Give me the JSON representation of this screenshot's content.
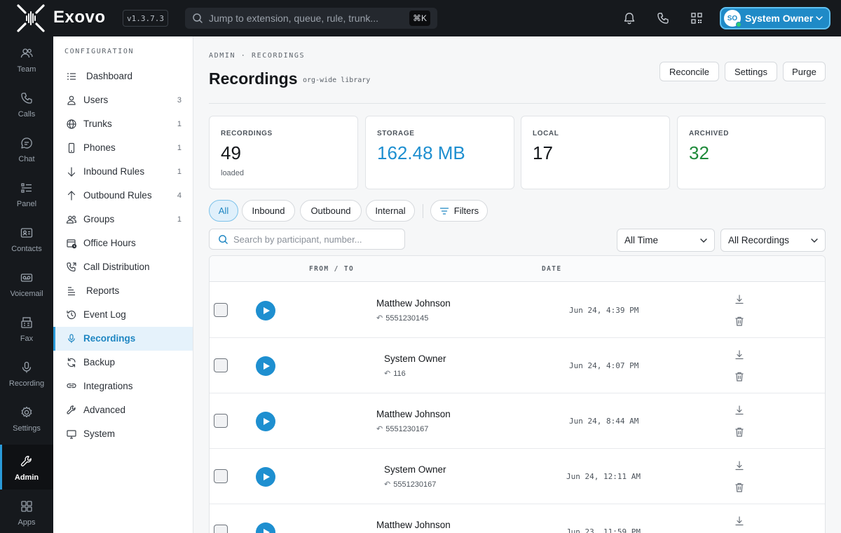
{
  "app": {
    "brand": "Exovo",
    "version": "v1.3.7.3",
    "search_placeholder": "Jump to extension, queue, rule, trunk...",
    "search_shortcut": "⌘K",
    "user": {
      "initials": "SO",
      "name": "System Owner"
    },
    "icons": [
      "logo-icon",
      "bell-icon",
      "phone-icon",
      "qr-icon",
      "chevron-down-icon"
    ]
  },
  "rail": [
    {
      "label": "Team",
      "icon": "team-icon"
    },
    {
      "label": "Calls",
      "icon": "phone-icon"
    },
    {
      "label": "Chat",
      "icon": "chat-icon"
    },
    {
      "label": "Panel",
      "icon": "panel-icon"
    },
    {
      "label": "Contacts",
      "icon": "contacts-icon"
    },
    {
      "label": "Voicemail",
      "icon": "voicemail-icon"
    },
    {
      "label": "Fax",
      "icon": "fax-icon"
    },
    {
      "label": "Recording",
      "icon": "mic-icon"
    },
    {
      "label": "Settings",
      "icon": "gear-icon"
    },
    {
      "label": "Admin",
      "icon": "wrench-icon",
      "active": true
    },
    {
      "label": "Apps",
      "icon": "apps-icon"
    }
  ],
  "config": {
    "heading": "CONFIGURATION",
    "items": [
      {
        "label": "Dashboard",
        "count": "",
        "icon": "dashboard-icon"
      },
      {
        "label": "Users",
        "count": "3",
        "icon": "user-icon"
      },
      {
        "label": "Trunks",
        "count": "1",
        "icon": "globe-icon"
      },
      {
        "label": "Phones",
        "count": "1",
        "icon": "mobile-icon"
      },
      {
        "label": "Inbound Rules",
        "count": "1",
        "icon": "arrow-down-icon"
      },
      {
        "label": "Outbound Rules",
        "count": "4",
        "icon": "arrow-up-icon"
      },
      {
        "label": "Groups",
        "count": "1",
        "icon": "groups-icon"
      },
      {
        "label": "Office Hours",
        "count": "",
        "icon": "calendar-clock-icon"
      },
      {
        "label": "Call Distribution",
        "count": "",
        "icon": "call-forward-icon"
      },
      {
        "label": "Reports",
        "count": "",
        "icon": "reports-icon"
      },
      {
        "label": "Event Log",
        "count": "",
        "icon": "history-icon"
      },
      {
        "label": "Recordings",
        "count": "",
        "icon": "mic-icon",
        "active": true
      },
      {
        "label": "Backup",
        "count": "",
        "icon": "backup-icon"
      },
      {
        "label": "Integrations",
        "count": "",
        "icon": "link-icon"
      },
      {
        "label": "Advanced",
        "count": "",
        "icon": "wrench-icon"
      },
      {
        "label": "System",
        "count": "",
        "icon": "monitor-icon"
      }
    ]
  },
  "page": {
    "breadcrumb": "ADMIN · RECORDINGS",
    "title": "Recordings",
    "subtitle": "org-wide library",
    "buttons": {
      "reconcile": "Reconcile",
      "settings": "Settings",
      "purge": "Purge"
    }
  },
  "stats": [
    {
      "label": "RECORDINGS",
      "value": "49",
      "sub": "loaded",
      "color": "#14171b"
    },
    {
      "label": "STORAGE",
      "value": "162.48 MB",
      "sub": "",
      "color": "#1e8fd0"
    },
    {
      "label": "LOCAL",
      "value": "17",
      "sub": "",
      "color": "#14171b"
    },
    {
      "label": "ARCHIVED",
      "value": "32",
      "sub": "",
      "color": "#1f8a3a"
    }
  ],
  "filters": {
    "pills": [
      "All",
      "Inbound",
      "Outbound",
      "Internal"
    ],
    "active": "All",
    "filters_label": "Filters",
    "search_placeholder": "Search by participant, number...",
    "time_select": "All Time",
    "type_select": "All Recordings"
  },
  "table": {
    "headers": {
      "from_to": "FROM / TO",
      "date": "DATE"
    },
    "rows": [
      {
        "name": "Matthew Johnson",
        "number": "5551230145",
        "date": "Jun 24, 4:39 PM"
      },
      {
        "name": "System Owner",
        "number": "116",
        "date": "Jun 24, 4:07 PM"
      },
      {
        "name": "Matthew Johnson",
        "number": "5551230167",
        "date": "Jun 24, 8:44 AM"
      },
      {
        "name": "System Owner",
        "number": "5551230167",
        "date": "Jun 24, 12:11 AM"
      },
      {
        "name": "Matthew Johnson",
        "number": "",
        "date": "Jun 23, 11:59 PM"
      }
    ]
  },
  "colors": {
    "accent": "#1e8fd0",
    "topbar": "#16191d",
    "archived": "#1f8a3a"
  }
}
